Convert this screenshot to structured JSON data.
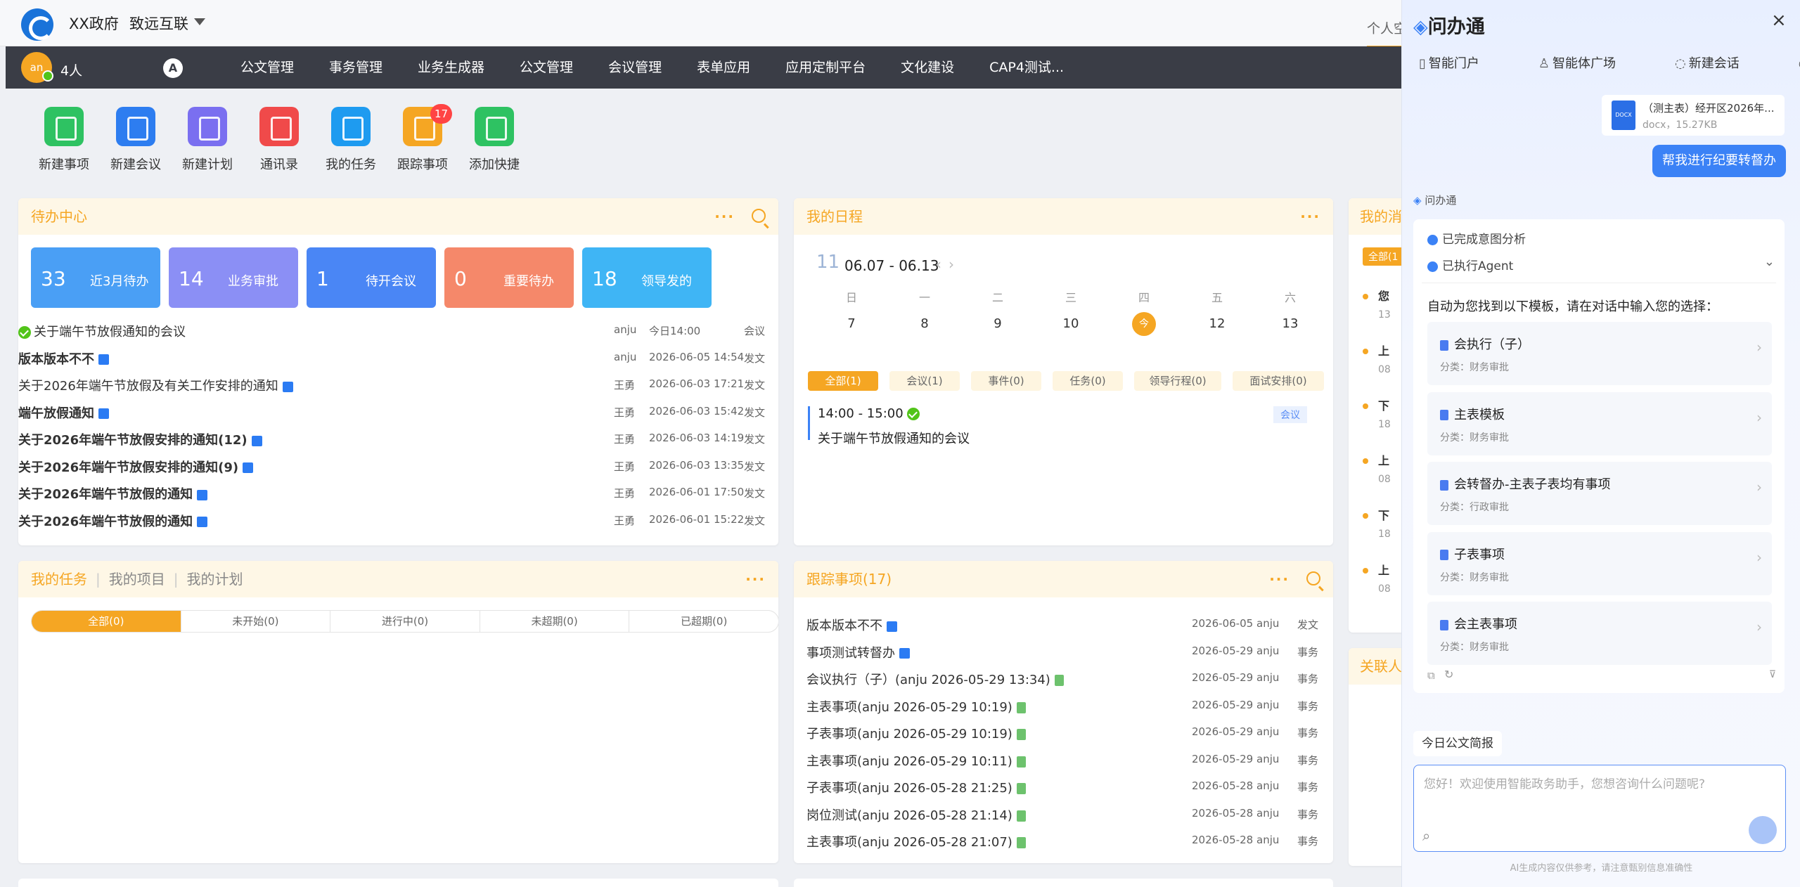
{
  "topbar": {
    "org": "XX政府",
    "org2": "致远互联",
    "personal_tab": "个人空"
  },
  "navbar": {
    "avatar": "an",
    "users": "4人",
    "nav_icon_text": "A",
    "menu": [
      "公文管理",
      "事务管理",
      "业务生成器",
      "公文管理",
      "会议管理",
      "表单应用",
      "应用定制平台",
      "文化建设",
      "CAP4测试..."
    ]
  },
  "quick": [
    {
      "label": "新建事项",
      "color": "#2ec262"
    },
    {
      "label": "新建会议",
      "color": "#2d7df0"
    },
    {
      "label": "新建计划",
      "color": "#7a6ff0"
    },
    {
      "label": "通讯录",
      "color": "#f04a4a"
    },
    {
      "label": "我的任务",
      "color": "#1e9bf0"
    },
    {
      "label": "跟踪事项",
      "color": "#f5a623",
      "badge": "17"
    },
    {
      "label": "添加快捷",
      "color": "#2ec262"
    }
  ],
  "todo": {
    "title": "待办中心",
    "more": "···",
    "stats": [
      {
        "num": "33",
        "label": "近3月待办",
        "color": "#4a9ff5"
      },
      {
        "num": "14",
        "label": "业务审批",
        "color": "#8b8ff5"
      },
      {
        "num": "1",
        "label": "待开会议",
        "color": "#4a86f5"
      },
      {
        "num": "0",
        "label": "重要待办",
        "color": "#f5886a"
      },
      {
        "num": "18",
        "label": "领导发的",
        "color": "#3fb5f5"
      }
    ],
    "rows": [
      {
        "title": "关于端午节放假通知的会议",
        "author": "anju",
        "date": "今日14:00",
        "type": "会议",
        "bold": false
      },
      {
        "title": "版本版本不不",
        "author": "anju",
        "date": "2026-06-05 14:54",
        "type": "发文",
        "bold": true
      },
      {
        "title": "关于2026年端午节放假及有关工作安排的通知",
        "author": "王勇",
        "date": "2026-06-03 17:21",
        "type": "发文",
        "bold": false
      },
      {
        "title": "端午放假通知",
        "author": "王勇",
        "date": "2026-06-03 15:42",
        "type": "发文",
        "bold": true
      },
      {
        "title": "关于2026年端午节放假安排的通知(12)",
        "author": "王勇",
        "date": "2026-06-03 14:19",
        "type": "发文",
        "bold": true
      },
      {
        "title": "关于2026年端午节放假安排的通知(9)",
        "author": "王勇",
        "date": "2026-06-03 13:35",
        "type": "发文",
        "bold": true
      },
      {
        "title": "关于2026年端午节放假的通知",
        "author": "王勇",
        "date": "2026-06-01 17:50",
        "type": "发文",
        "bold": true
      },
      {
        "title": "关于2026年端午节放假的通知",
        "author": "王勇",
        "date": "2026-06-01 15:22",
        "type": "发文",
        "bold": true
      }
    ]
  },
  "schedule": {
    "title": "我的日程",
    "more": "···",
    "day": "11",
    "range": "06.07 - 06.13",
    "weekdays": [
      "日",
      "一",
      "二",
      "三",
      "四",
      "五",
      "六"
    ],
    "dates": [
      "7",
      "8",
      "9",
      "10",
      "今",
      "12",
      "13"
    ],
    "tabs": [
      "全部(1)",
      "会议(1)",
      "事件(0)",
      "任务(0)",
      "领导行程(0)",
      "面试安排(0)"
    ],
    "event": {
      "time": "14:00 - 15:00",
      "title": "关于端午节放假通知的会议",
      "tag": "会议"
    }
  },
  "messages": {
    "title": "我的消",
    "tab": "全部(1",
    "items": [
      "您",
      "上",
      "下",
      "上",
      "下",
      "上"
    ],
    "subs": [
      "13",
      "08",
      "18",
      "08",
      "18",
      "08"
    ]
  },
  "related": {
    "title": "关联人"
  },
  "tasks": {
    "tabs": [
      "我的任务",
      "我的项目",
      "我的计划"
    ],
    "more": "···",
    "filters": [
      "全部(0)",
      "未开始(0)",
      "进行中(0)",
      "未超期(0)",
      "已超期(0)"
    ]
  },
  "tracking": {
    "title": "跟踪事项(17)",
    "more": "···",
    "rows": [
      {
        "title": "版本版本不不",
        "date": "2026-06-05",
        "author": "anju",
        "type": "发文",
        "icon": "word"
      },
      {
        "title": "事项测试转督办",
        "date": "2026-05-29",
        "author": "anju",
        "type": "事务",
        "icon": "word"
      },
      {
        "title": "会议执行（子）(anju 2026-05-29 13:34)",
        "date": "2026-05-29",
        "author": "anju",
        "type": "事务",
        "icon": "form"
      },
      {
        "title": "主表事项(anju 2026-05-29 10:19)",
        "date": "2026-05-29",
        "author": "anju",
        "type": "事务",
        "icon": "form"
      },
      {
        "title": "子表事项(anju 2026-05-29 10:19)",
        "date": "2026-05-29",
        "author": "anju",
        "type": "事务",
        "icon": "form"
      },
      {
        "title": "主表事项(anju 2026-05-29 10:11)",
        "date": "2026-05-29",
        "author": "anju",
        "type": "事务",
        "icon": "form"
      },
      {
        "title": "子表事项(anju 2026-05-28 21:25)",
        "date": "2026-05-28",
        "author": "anju",
        "type": "事务",
        "icon": "form"
      },
      {
        "title": "岗位测试(anju 2026-05-28 21:14)",
        "date": "2026-05-28",
        "author": "anju",
        "type": "事务",
        "icon": "form"
      },
      {
        "title": "主表事项(anju 2026-05-28 21:07)",
        "date": "2026-05-28",
        "author": "anju",
        "type": "事务",
        "icon": "form"
      }
    ]
  },
  "chat": {
    "title": "问办通",
    "close": "×",
    "nav": [
      "智能门户",
      "智能体广场",
      "新建会话",
      "历史会话"
    ],
    "file": {
      "name": "（测主表）经开区2026年...",
      "meta": "docx，15.27KB",
      "icon": "DOCX"
    },
    "user_msg": "帮我进行纪要转督办",
    "bot_name": "问办通",
    "steps": [
      "已完成意图分析",
      "已执行Agent"
    ],
    "intro": "自动为您找到以下模板，请在对话中输入您的选择：",
    "templates": [
      {
        "name": "会执行（子）",
        "cat": "分类：财务审批"
      },
      {
        "name": "主表模板",
        "cat": "分类：财务审批"
      },
      {
        "name": "会转督办-主表子表均有事项",
        "cat": "分类：行政审批"
      },
      {
        "name": "子表事项",
        "cat": "分类：财务审批"
      },
      {
        "name": "会主表事项",
        "cat": "分类：财务审批"
      }
    ],
    "briefing": "今日公文简报",
    "placeholder": "您好！欢迎使用智能政务助手，您想咨询什么问题呢?",
    "disclaimer": "AI生成内容仅供参考，请注意甄别信息准确性"
  }
}
